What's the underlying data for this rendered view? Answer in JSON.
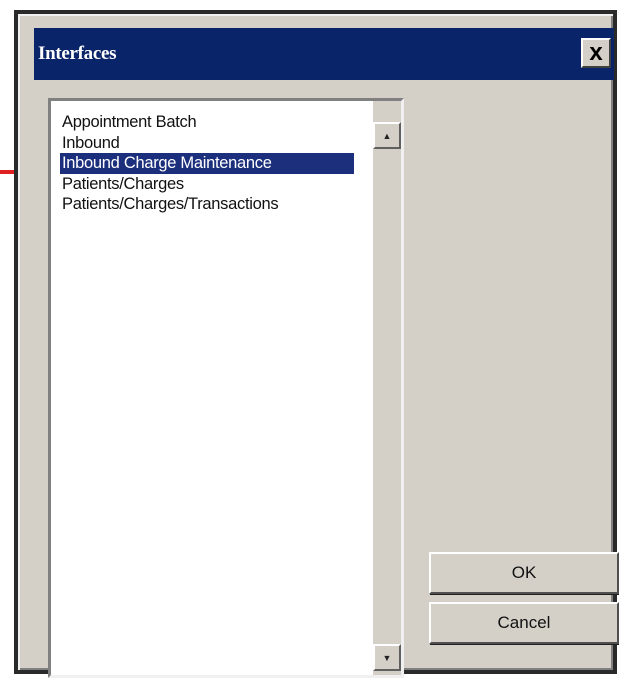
{
  "dialog": {
    "title": "Interfaces",
    "close_glyph": "x",
    "close_icon": "close-icon"
  },
  "listbox": {
    "items": [
      {
        "label": "Appointment Batch"
      },
      {
        "label": "Inbound"
      },
      {
        "label": "Inbound Charge Maintenance",
        "selected": true
      },
      {
        "label": "Patients/Charges"
      },
      {
        "label": "Patients/Charges/Transactions"
      }
    ],
    "scroll_up_icon": "scroll-up-arrow-icon",
    "scroll_down_icon": "scroll-down-arrow-icon"
  },
  "buttons": {
    "ok_label": "OK",
    "cancel_label": "Cancel"
  },
  "annotation": {
    "arrow_icon": "red-arrow-icon",
    "arrow_color": "#e02020"
  },
  "colors": {
    "titlebar": "#0a246a",
    "selection": "#1c2f7d",
    "dialog_face": "#d4d0c8"
  }
}
